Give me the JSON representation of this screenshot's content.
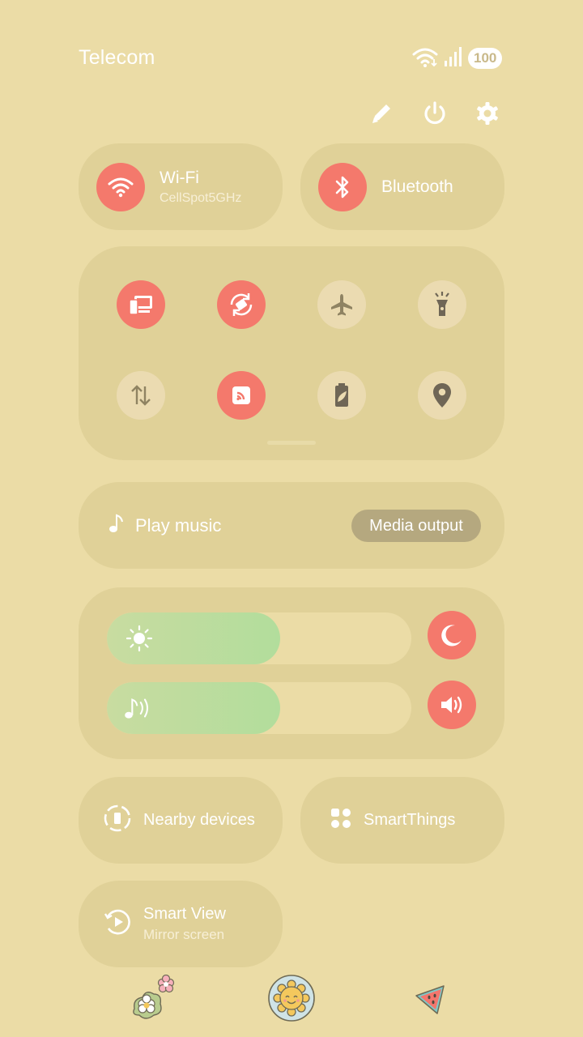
{
  "status_bar": {
    "carrier": "Telecom",
    "battery": "100",
    "icons": [
      "wifi-icon",
      "signal-icon",
      "battery-icon"
    ]
  },
  "top_actions": [
    "edit-icon",
    "power-icon",
    "settings-icon"
  ],
  "tiles": {
    "wifi": {
      "title": "Wi-Fi",
      "subtitle": "CellSpot5GHz",
      "on": true
    },
    "bluetooth": {
      "title": "Bluetooth",
      "on": true
    }
  },
  "quick_settings": [
    {
      "icon": "cast-devices-icon",
      "on": true
    },
    {
      "icon": "auto-rotate-icon",
      "on": true
    },
    {
      "icon": "airplane-icon",
      "on": false
    },
    {
      "icon": "flashlight-icon",
      "on": false
    },
    {
      "icon": "mobile-data-icon",
      "on": false
    },
    {
      "icon": "hotspot-icon",
      "on": true
    },
    {
      "icon": "power-saving-icon",
      "on": false
    },
    {
      "icon": "location-icon",
      "on": false
    }
  ],
  "media": {
    "play_label": "Play music",
    "output_label": "Media output"
  },
  "sliders": {
    "brightness_level": 0.57,
    "volume_level": 0.57
  },
  "bottom_tiles": {
    "nearby": "Nearby devices",
    "smartthings": "SmartThings",
    "smart_view_title": "Smart View",
    "smart_view_sub": "Mirror screen"
  },
  "colors": {
    "background": "#ebdca6",
    "card": "#e0d198",
    "accent_on": "#f4796c",
    "slider_fill": "#b2dd9c"
  }
}
